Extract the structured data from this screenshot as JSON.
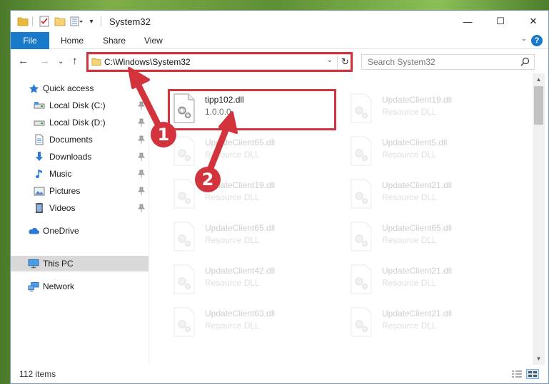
{
  "window": {
    "title": "System32",
    "controls": {
      "minimize": "—",
      "maximize": "☐",
      "close": "✕"
    }
  },
  "ribbon": {
    "tabs": [
      "File",
      "Home",
      "Share",
      "View"
    ]
  },
  "navigation": {
    "address": "C:\\Windows\\System32",
    "search_placeholder": "Search System32"
  },
  "sidebar": {
    "items": [
      {
        "label": "Quick access",
        "icon": "star-icon",
        "pinned": false
      },
      {
        "label": "Local Disk (C:)",
        "icon": "drive-icon",
        "pinned": true
      },
      {
        "label": "Local Disk (D:)",
        "icon": "drive-icon",
        "pinned": true
      },
      {
        "label": "Documents",
        "icon": "documents-icon",
        "pinned": true
      },
      {
        "label": "Downloads",
        "icon": "downloads-icon",
        "pinned": true
      },
      {
        "label": "Music",
        "icon": "music-icon",
        "pinned": true
      },
      {
        "label": "Pictures",
        "icon": "pictures-icon",
        "pinned": true
      },
      {
        "label": "Videos",
        "icon": "videos-icon",
        "pinned": true
      },
      {
        "label": "OneDrive",
        "icon": "onedrive-icon",
        "pinned": false
      },
      {
        "label": "This PC",
        "icon": "pc-icon",
        "pinned": false,
        "selected": true
      },
      {
        "label": "Network",
        "icon": "network-icon",
        "pinned": false
      }
    ]
  },
  "files": {
    "highlighted": {
      "name": "tipp102.dll",
      "desc": "1.0.0.0"
    },
    "col1": [
      {
        "name": "UpdateClient65.dll",
        "desc": "Resource DLL"
      },
      {
        "name": "UpdateClient19.dll",
        "desc": "Resource DLL"
      },
      {
        "name": "UpdateClient65.dll",
        "desc": "Resource DLL"
      },
      {
        "name": "UpdateClient42.dll",
        "desc": "Resource DLL"
      },
      {
        "name": "UpdateClient63.dll",
        "desc": "Resource DLL"
      }
    ],
    "col2": [
      {
        "name": "UpdateClient19.dll",
        "desc": "Resource DLL"
      },
      {
        "name": "UpdateClient5.dll",
        "desc": "Resource DLL"
      },
      {
        "name": "UpdateClient21.dll",
        "desc": "Resource DLL"
      },
      {
        "name": "UpdateClient65.dll",
        "desc": "Resource DLL"
      },
      {
        "name": "UpdateClient21.dll",
        "desc": "Resource DLL"
      },
      {
        "name": "UpdateClient21.dll",
        "desc": "Resource DLL"
      }
    ]
  },
  "status": {
    "item_count": "112 items"
  },
  "annotations": {
    "step1": "1",
    "step2": "2",
    "color": "#d3333d"
  },
  "colors": {
    "accent": "#1979ca",
    "folder": "#e8b93b",
    "selection": "#d9d9d9"
  }
}
